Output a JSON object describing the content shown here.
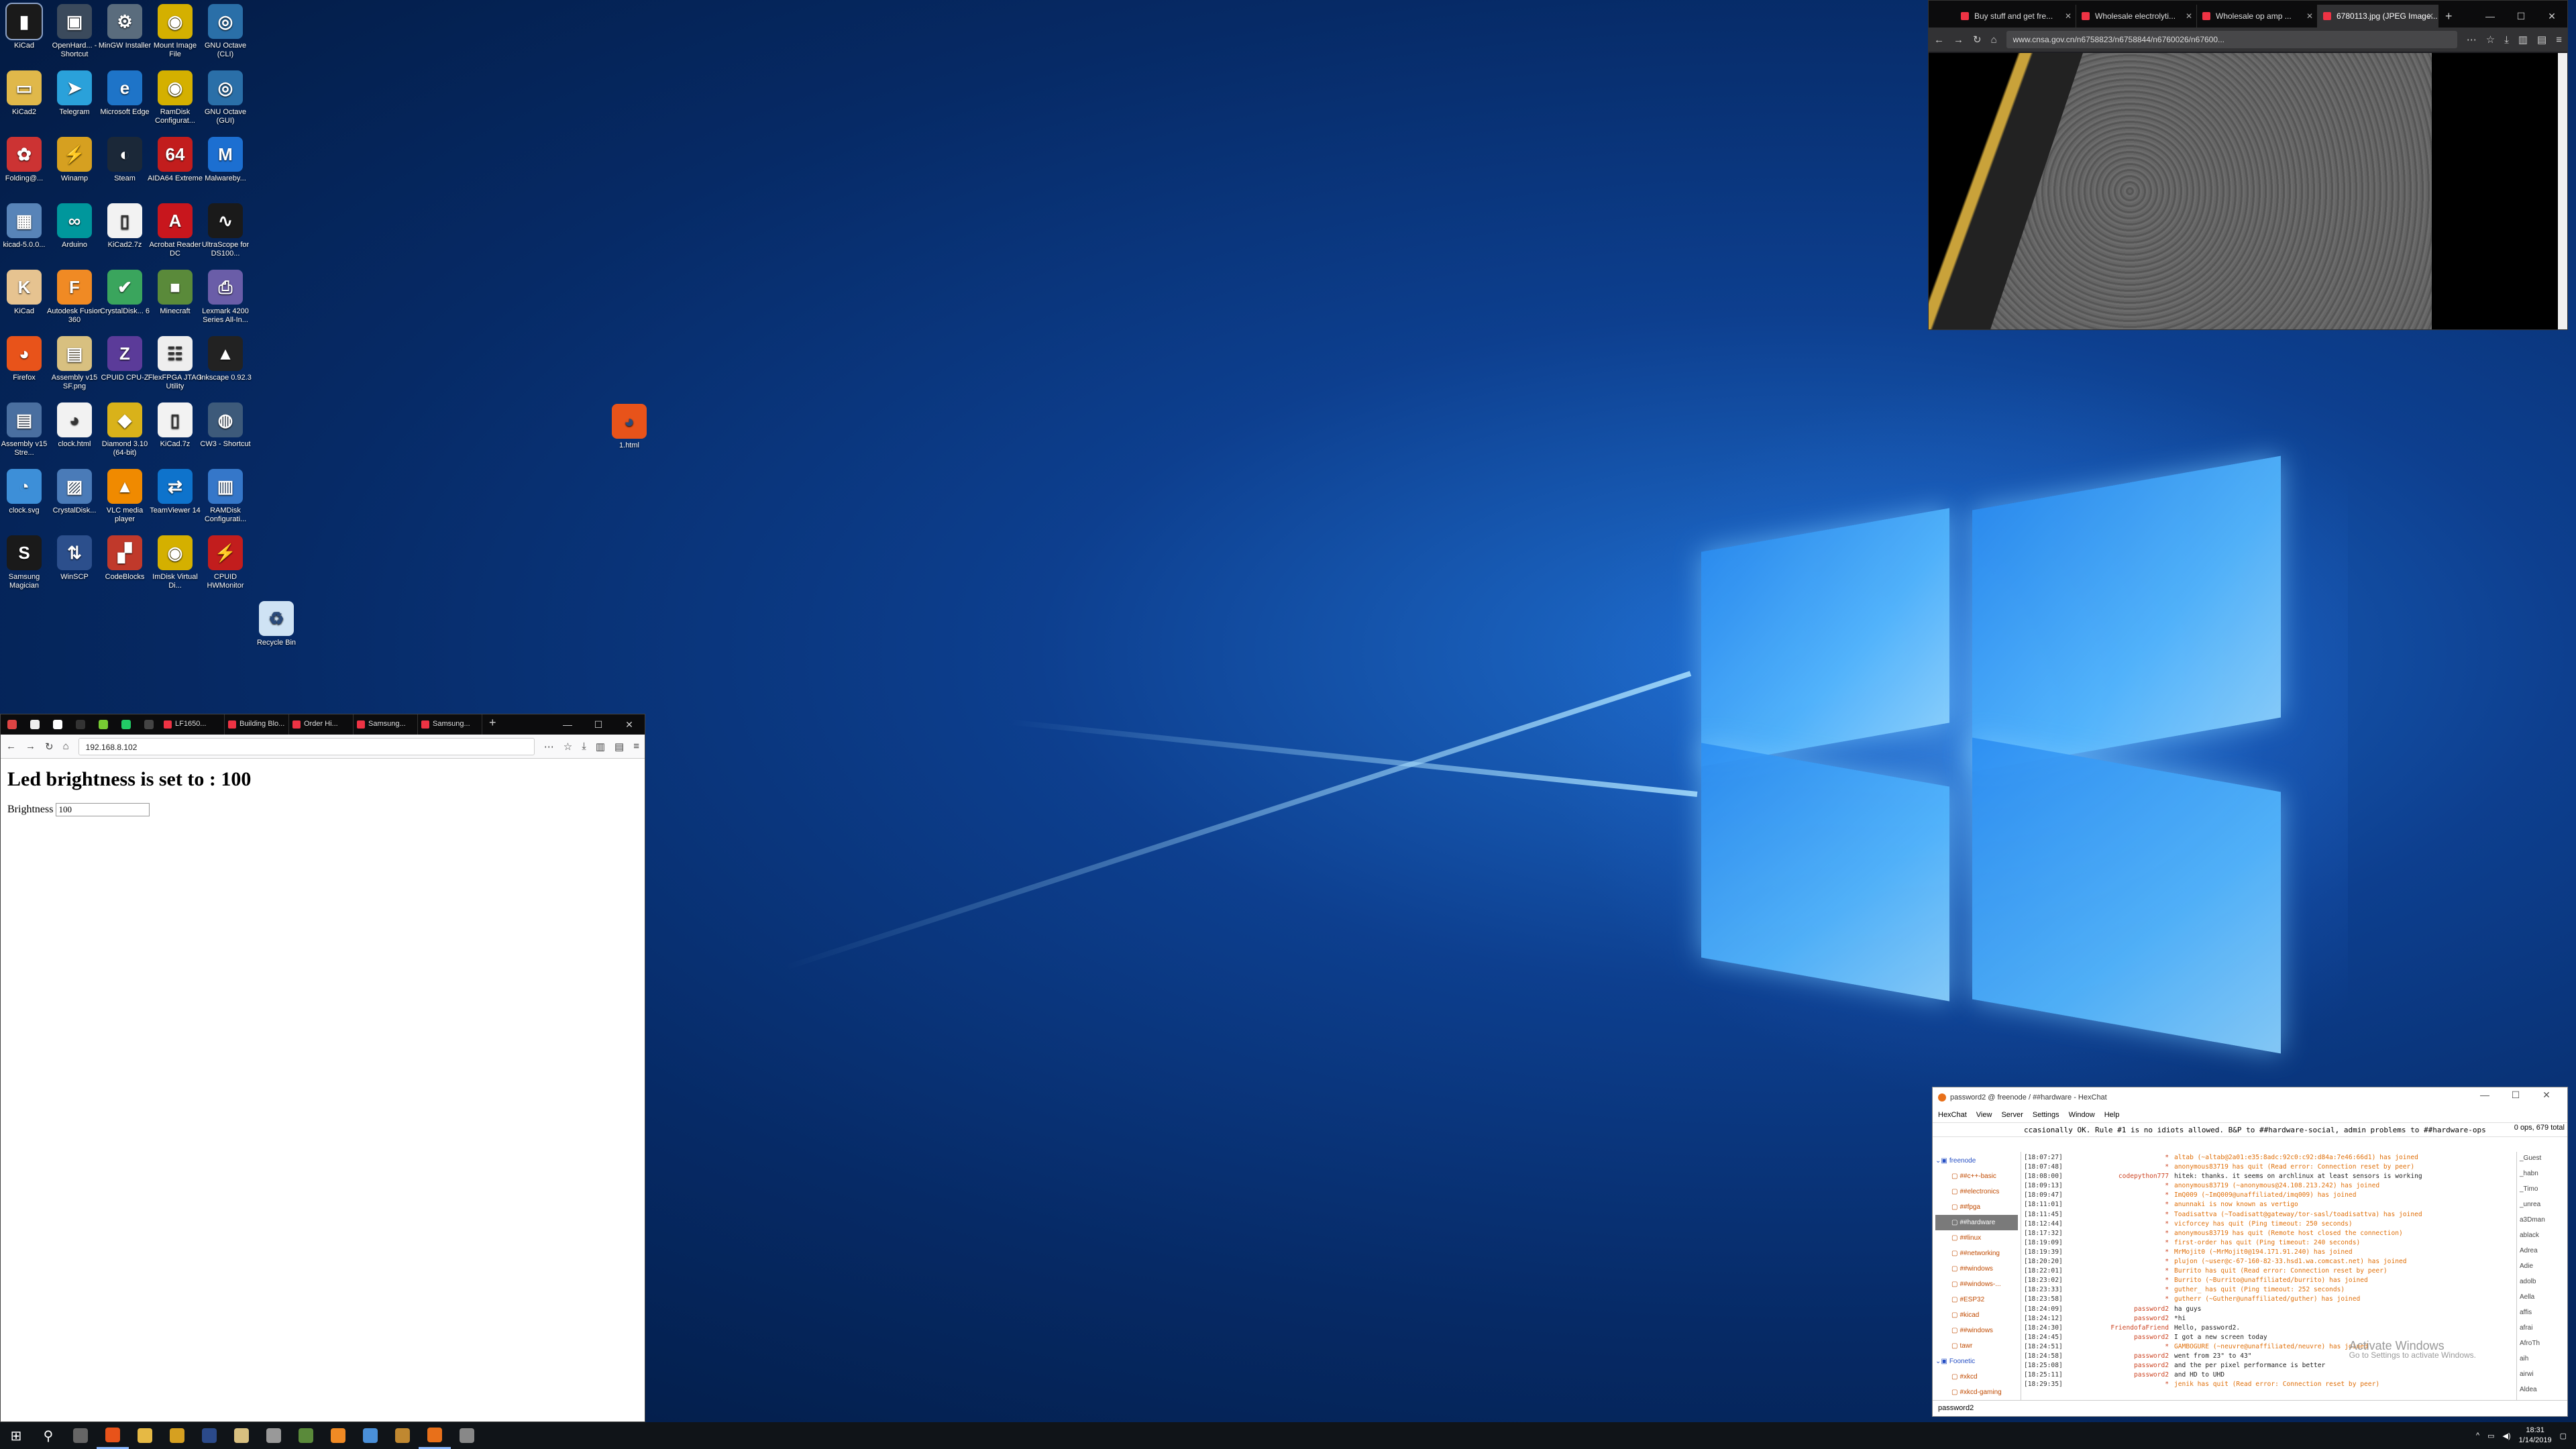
{
  "desktop": {
    "icons": [
      {
        "label": "KiCad",
        "icon": "kicad-doc-icon",
        "color": "#1a1a1a",
        "glyph": "▮"
      },
      {
        "label": "OpenHard... - Shortcut",
        "icon": "hardware-monitor-icon",
        "color": "#3b4a5c",
        "glyph": "▣"
      },
      {
        "label": "MinGW Installer",
        "icon": "mingw-icon",
        "color": "#5a6c7d",
        "glyph": "⚙"
      },
      {
        "label": "Mount Image File",
        "icon": "disc-icon",
        "color": "#d4b000",
        "glyph": "◉"
      },
      {
        "label": "GNU Octave (CLI)",
        "icon": "octave-icon",
        "color": "#2a6fa8",
        "glyph": "◎"
      },
      {
        "label": "KiCad2",
        "icon": "folder-icon",
        "color": "#e0b84a",
        "glyph": "▭"
      },
      {
        "label": "Telegram",
        "icon": "telegram-icon",
        "color": "#2aa1da",
        "glyph": "➤"
      },
      {
        "label": "Microsoft Edge",
        "icon": "edge-icon",
        "color": "#1e74c8",
        "glyph": "e"
      },
      {
        "label": "RamDisk Configurat...",
        "icon": "disc-icon",
        "color": "#d4b000",
        "glyph": "◉"
      },
      {
        "label": "GNU Octave (GUI)",
        "icon": "octave-icon",
        "color": "#2a6fa8",
        "glyph": "◎"
      },
      {
        "label": "Folding@...",
        "icon": "folding-icon",
        "color": "#c33",
        "glyph": "✿"
      },
      {
        "label": "Winamp",
        "icon": "winamp-icon",
        "color": "#d6a020",
        "glyph": "⚡"
      },
      {
        "label": "Steam",
        "icon": "steam-icon",
        "color": "#1b2838",
        "glyph": "◐"
      },
      {
        "label": "AIDA64 Extreme",
        "icon": "aida64-icon",
        "color": "#c21d1d",
        "glyph": "64"
      },
      {
        "label": "Malwareby...",
        "icon": "malwarebytes-icon",
        "color": "#1c6fd1",
        "glyph": "M"
      },
      {
        "label": "kicad-5.0.0...",
        "icon": "installer-icon",
        "color": "#5884b8",
        "glyph": "▦"
      },
      {
        "label": "Arduino",
        "icon": "arduino-icon",
        "color": "#00979c",
        "glyph": "∞"
      },
      {
        "label": "KiCad2.7z",
        "icon": "file-icon",
        "color": "#f2f2f2",
        "glyph": "▯"
      },
      {
        "label": "Acrobat Reader DC",
        "icon": "acrobat-icon",
        "color": "#c8161d",
        "glyph": "A"
      },
      {
        "label": "UltraScope for DS100...",
        "icon": "scope-icon",
        "color": "#1a1a1a",
        "glyph": "∿"
      },
      {
        "label": "KiCad",
        "icon": "kicad-icon",
        "color": "#e6c390",
        "glyph": "K"
      },
      {
        "label": "Autodesk Fusion 360",
        "icon": "fusion-icon",
        "color": "#f08a24",
        "glyph": "F"
      },
      {
        "label": "CrystalDisk... 6",
        "icon": "crystaldisk-icon",
        "color": "#3aa55d",
        "glyph": "✔"
      },
      {
        "label": "Minecraft",
        "icon": "minecraft-icon",
        "color": "#5a8a3a",
        "glyph": "■"
      },
      {
        "label": "Lexmark 4200 Series All-In...",
        "icon": "printer-icon",
        "color": "#6a5da8",
        "glyph": "⎙"
      },
      {
        "label": "Firefox",
        "icon": "firefox-icon",
        "color": "#e8531a",
        "glyph": "◕"
      },
      {
        "label": "Assembly v15 SF.png",
        "icon": "image-icon",
        "color": "#d8c080",
        "glyph": "▤"
      },
      {
        "label": "CPUID CPU-Z",
        "icon": "cpuz-icon",
        "color": "#5b3b99",
        "glyph": "Z"
      },
      {
        "label": "FlexFPGA JTAG Utility",
        "icon": "jtag-icon",
        "color": "#eeeeee",
        "glyph": "☷"
      },
      {
        "label": "Inkscape 0.92.3",
        "icon": "inkscape-icon",
        "color": "#222",
        "glyph": "▲"
      },
      {
        "label": "Assembly v15 Stre...",
        "icon": "image-icon",
        "color": "#4a6fa0",
        "glyph": "▤"
      },
      {
        "label": "clock.html",
        "icon": "html-file-icon",
        "color": "#f2f2f2",
        "glyph": "◕"
      },
      {
        "label": "Diamond 3.10 (64-bit)",
        "icon": "diamond-icon",
        "color": "#d9b21a",
        "glyph": "◆"
      },
      {
        "label": "KiCad.7z",
        "icon": "file-icon",
        "color": "#f2f2f2",
        "glyph": "▯"
      },
      {
        "label": "CW3 - Shortcut",
        "icon": "cw3-icon",
        "color": "#3d5a7a",
        "glyph": "◍"
      },
      {
        "label": "clock.svg",
        "icon": "svg-file-icon",
        "color": "#3d8fd8",
        "glyph": "◔"
      },
      {
        "label": "CrystalDisk...",
        "icon": "crystaldisk-icon",
        "color": "#4a7bb8",
        "glyph": "▨"
      },
      {
        "label": "VLC media player",
        "icon": "vlc-icon",
        "color": "#f08a00",
        "glyph": "▲"
      },
      {
        "label": "TeamViewer 14",
        "icon": "teamviewer-icon",
        "color": "#0e73cc",
        "glyph": "⇄"
      },
      {
        "label": "RAMDisk Configurati...",
        "icon": "ramdisk-icon",
        "color": "#3577c9",
        "glyph": "▥"
      },
      {
        "label": "Samsung Magician",
        "icon": "samsung-icon",
        "color": "#1a1a1a",
        "glyph": "S"
      },
      {
        "label": "WinSCP",
        "icon": "winscp-icon",
        "color": "#2c4f8c",
        "glyph": "⇅"
      },
      {
        "label": "CodeBlocks",
        "icon": "codeblocks-icon",
        "color": "#c0392b",
        "glyph": "▞"
      },
      {
        "label": "ImDisk Virtual Di...",
        "icon": "disc-icon",
        "color": "#d4b000",
        "glyph": "◉"
      },
      {
        "label": "CPUID HWMonitor",
        "icon": "hwmonitor-icon",
        "color": "#c21d1d",
        "glyph": "⚡"
      }
    ],
    "extra_icons": [
      {
        "label": "1.html",
        "icon": "html-file-icon",
        "color": "#e8531a",
        "glyph": "◕"
      },
      {
        "label": "Recycle Bin",
        "icon": "recycle-bin-icon",
        "color": "#cfe3f4",
        "glyph": "♻"
      }
    ]
  },
  "browser_top": {
    "tabs": [
      {
        "label": "Buy stuff and get fre...",
        "active": false
      },
      {
        "label": "Wholesale electrolyti...",
        "active": false
      },
      {
        "label": "Wholesale op amp ...",
        "active": false
      },
      {
        "label": "6780113.jpg (JPEG Image...",
        "active": true
      }
    ],
    "url": "www.cnsa.gov.cn/n6758823/n6758844/n6760026/n67600..."
  },
  "browser_left": {
    "tabs": [
      "LF1650...",
      "Building Blo...",
      "Order Hi...",
      "Samsung...",
      "Samsung..."
    ],
    "url": "192.168.8.102",
    "heading": "Led brightness is set to : 100",
    "brightness_label": "Brightness",
    "brightness_value": "100"
  },
  "hexchat": {
    "title": "password2 @ freenode / ##hardware - HexChat",
    "menu": [
      "HexChat",
      "View",
      "Server",
      "Settings",
      "Window",
      "Help"
    ],
    "topic": "ccasionally OK. Rule #1 is no idiots allowed. B&P to ##hardware-social, admin problems to ##hardware-ops",
    "ops": "0 ops, 679 total",
    "tree": [
      {
        "label": "freenode",
        "type": "server"
      },
      {
        "label": "##c++-basic",
        "type": "chan"
      },
      {
        "label": "##electronics",
        "type": "chan"
      },
      {
        "label": "##fpga",
        "type": "chan"
      },
      {
        "label": "##hardware",
        "type": "chan",
        "sel": true
      },
      {
        "label": "##linux",
        "type": "chan"
      },
      {
        "label": "##networking",
        "type": "chan"
      },
      {
        "label": "##windows",
        "type": "chan"
      },
      {
        "label": "##windows-...",
        "type": "chan"
      },
      {
        "label": "#ESP32",
        "type": "chan"
      },
      {
        "label": "#kicad",
        "type": "chan"
      },
      {
        "label": "##windows",
        "type": "chan"
      },
      {
        "label": "tawr",
        "type": "chan"
      },
      {
        "label": "Foonetic",
        "type": "server"
      },
      {
        "label": "#xkcd",
        "type": "chan"
      },
      {
        "label": "#xkcd-gaming",
        "type": "chan"
      }
    ],
    "log": [
      {
        "ts": "[18:07:27]",
        "nick": "*",
        "msg": "altab (~altab@2a01:e35:8adc:92c0:c92:d84a:7e46:66d1) has joined",
        "chat": false
      },
      {
        "ts": "[18:07:48]",
        "nick": "*",
        "msg": "anonymous83719 has quit (Read error: Connection reset by peer)",
        "chat": false
      },
      {
        "ts": "[18:08:00]",
        "nick": "codepython777",
        "msg": "hitek: thanks. it seems on archlinux at least sensors is working",
        "chat": true
      },
      {
        "ts": "[18:09:13]",
        "nick": "*",
        "msg": "anonymous83719 (~anonymous@24.108.213.242) has joined",
        "chat": false
      },
      {
        "ts": "[18:09:47]",
        "nick": "*",
        "msg": "ImQ009 (~ImQ009@unaffiliated/imq009) has joined",
        "chat": false
      },
      {
        "ts": "[18:11:01]",
        "nick": "*",
        "msg": "anunnaki is now known as vertigo",
        "chat": false
      },
      {
        "ts": "[18:11:45]",
        "nick": "*",
        "msg": "Toadisattva (~Toadisatt@gateway/tor-sasl/toadisattva) has joined",
        "chat": false
      },
      {
        "ts": "[18:12:44]",
        "nick": "*",
        "msg": "vicforcey has quit (Ping timeout: 250 seconds)",
        "chat": false
      },
      {
        "ts": "[18:17:32]",
        "nick": "*",
        "msg": "anonymous83719 has quit (Remote host closed the connection)",
        "chat": false
      },
      {
        "ts": "[18:19:09]",
        "nick": "*",
        "msg": "first-order has quit (Ping timeout: 240 seconds)",
        "chat": false
      },
      {
        "ts": "[18:19:39]",
        "nick": "*",
        "msg": "MrMojit0 (~MrMojit0@194.171.91.240) has joined",
        "chat": false
      },
      {
        "ts": "[18:20:20]",
        "nick": "*",
        "msg": "plujon (~user@c-67-160-82-33.hsd1.wa.comcast.net) has joined",
        "chat": false
      },
      {
        "ts": "[18:22:01]",
        "nick": "*",
        "msg": "Burrito has quit (Read error: Connection reset by peer)",
        "chat": false
      },
      {
        "ts": "[18:23:02]",
        "nick": "*",
        "msg": "Burrito (~Burrito@unaffiliated/burrito) has joined",
        "chat": false
      },
      {
        "ts": "[18:23:33]",
        "nick": "*",
        "msg": "guther_ has quit (Ping timeout: 252 seconds)",
        "chat": false
      },
      {
        "ts": "[18:23:58]",
        "nick": "*",
        "msg": "gutherr (~Guther@unaffiliated/guther) has joined",
        "chat": false
      },
      {
        "ts": "[18:24:09]",
        "nick": "password2",
        "msg": "ha guys",
        "chat": true
      },
      {
        "ts": "[18:24:12]",
        "nick": "password2",
        "msg": "*hi",
        "chat": true
      },
      {
        "ts": "[18:24:30]",
        "nick": "FriendofaFriend",
        "msg": "Hello, password2.",
        "chat": true
      },
      {
        "ts": "[18:24:45]",
        "nick": "password2",
        "msg": "I got a new screen today",
        "chat": true
      },
      {
        "ts": "[18:24:51]",
        "nick": "*",
        "msg": "GAMBOGURE (~neuvre@unaffiliated/neuvre) has joined",
        "chat": false
      },
      {
        "ts": "[18:24:58]",
        "nick": "password2",
        "msg": "went from 23\" to 43\"",
        "chat": true
      },
      {
        "ts": "[18:25:08]",
        "nick": "password2",
        "msg": "and the per pixel performance is better",
        "chat": true
      },
      {
        "ts": "[18:25:11]",
        "nick": "password2",
        "msg": "and HD to UHD",
        "chat": true
      },
      {
        "ts": "[18:29:35]",
        "nick": "*",
        "msg": "jenik has quit (Read error: Connection reset by peer)",
        "chat": false
      }
    ],
    "users": [
      "_Guest",
      "_habn",
      "_Timo",
      "_unrea",
      "a3Dman",
      "ablack",
      "Adrea",
      "Adie",
      "adolb",
      "Aella",
      "affis",
      "afrai",
      "AfroTh",
      "aih",
      "airwi",
      "Aldea"
    ],
    "activate_title": "Activate Windows",
    "activate_sub": "Go to Settings to activate Windows.",
    "input_nick": "password2"
  },
  "taskbar": {
    "time": "18:31",
    "date": "1/14/2019",
    "apps": [
      {
        "icon": "task-view-icon",
        "color": "#666"
      },
      {
        "icon": "firefox-icon",
        "color": "#e8531a"
      },
      {
        "icon": "file-explorer-icon",
        "color": "#e6b944"
      },
      {
        "icon": "winamp-icon",
        "color": "#d6a020"
      },
      {
        "icon": "kicad-icon",
        "color": "#2b4a8a"
      },
      {
        "icon": "document-icon",
        "color": "#d8c080"
      },
      {
        "icon": "explorer-icon",
        "color": "#999"
      },
      {
        "icon": "minecraft-icon",
        "color": "#5a8a3a"
      },
      {
        "icon": "fusion-icon",
        "color": "#f08a24"
      },
      {
        "icon": "network-icon",
        "color": "#4a90d9"
      },
      {
        "icon": "app-icon",
        "color": "#c08830"
      },
      {
        "icon": "hexchat-icon",
        "color": "#e8701a"
      },
      {
        "icon": "settings-icon",
        "color": "#888"
      }
    ]
  }
}
